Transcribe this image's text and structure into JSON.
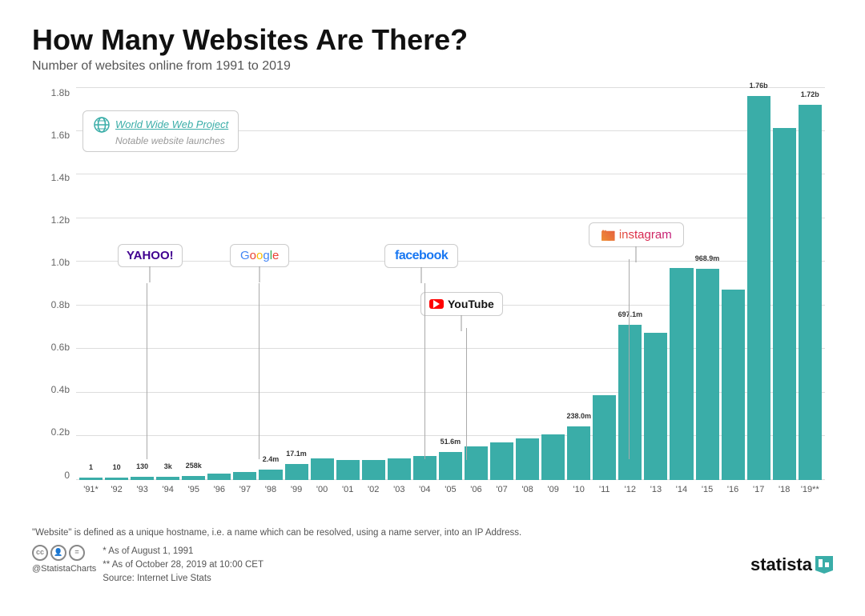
{
  "title": "How Many Websites Are There?",
  "subtitle": "Number of websites online from 1991 to 2019",
  "yLabels": [
    "0",
    "0.2b",
    "0.4b",
    "0.6b",
    "0.8b",
    "1.0b",
    "1.2b",
    "1.4b",
    "1.6b",
    "1.8b"
  ],
  "bars": [
    {
      "year": "'91*",
      "value": 1,
      "label": "1",
      "pct": 0.0006
    },
    {
      "year": "'92",
      "value": 10,
      "label": "10",
      "pct": 0.006
    },
    {
      "year": "'93",
      "value": 130,
      "label": "130",
      "pct": 0.007
    },
    {
      "year": "'94",
      "value": 3000,
      "label": "3k",
      "pct": 0.008
    },
    {
      "year": "'95",
      "value": 258000,
      "label": "258k",
      "pct": 0.01
    },
    {
      "year": "'96",
      "value": 0,
      "label": "",
      "pct": 0.015
    },
    {
      "year": "'97",
      "value": 0,
      "label": "",
      "pct": 0.02
    },
    {
      "year": "'98",
      "value": 2400000,
      "label": "2.4m",
      "pct": 0.025
    },
    {
      "year": "'99",
      "value": 17100000,
      "label": "17.1m",
      "pct": 0.04
    },
    {
      "year": "'00",
      "value": 0,
      "label": "",
      "pct": 0.055
    },
    {
      "year": "'01",
      "value": 0,
      "label": "",
      "pct": 0.05
    },
    {
      "year": "'02",
      "value": 0,
      "label": "",
      "pct": 0.05
    },
    {
      "year": "'03",
      "value": 0,
      "label": "",
      "pct": 0.055
    },
    {
      "year": "'04",
      "value": 0,
      "label": "",
      "pct": 0.06
    },
    {
      "year": "'05",
      "value": 51600000,
      "label": "51.6m",
      "pct": 0.07
    },
    {
      "year": "'06",
      "value": 0,
      "label": "",
      "pct": 0.085
    },
    {
      "year": "'07",
      "value": 0,
      "label": "",
      "pct": 0.095
    },
    {
      "year": "'08",
      "value": 0,
      "label": "",
      "pct": 0.105
    },
    {
      "year": "'09",
      "value": 0,
      "label": "",
      "pct": 0.115
    },
    {
      "year": "'10",
      "value": 238000000,
      "label": "238.0m",
      "pct": 0.135
    },
    {
      "year": "'11",
      "value": 0,
      "label": "",
      "pct": 0.215
    },
    {
      "year": "'12",
      "value": 697100000,
      "label": "697.1m",
      "pct": 0.395
    },
    {
      "year": "'13",
      "value": 0,
      "label": "",
      "pct": 0.375
    },
    {
      "year": "'14",
      "value": 0,
      "label": "",
      "pct": 0.54
    },
    {
      "year": "'15",
      "value": 968900000,
      "label": "968.9m",
      "pct": 0.538
    },
    {
      "year": "'16",
      "value": 0,
      "label": "",
      "pct": 0.485
    },
    {
      "year": "'17",
      "value": 1760000000,
      "label": "1.76b",
      "pct": 0.978
    },
    {
      "year": "'18",
      "value": 0,
      "label": "",
      "pct": 0.898
    },
    {
      "year": "'19**",
      "value": 1720000000,
      "label": "1.72b",
      "pct": 0.956
    }
  ],
  "annotations": [
    {
      "id": "wwwproject",
      "text": "World Wide Web Project",
      "subtext": "Notable website launches"
    },
    {
      "id": "yahoo",
      "text": "YAHOO!"
    },
    {
      "id": "google",
      "text": "Google"
    },
    {
      "id": "facebook",
      "text": "facebook"
    },
    {
      "id": "youtube",
      "text": "YouTube"
    },
    {
      "id": "instagram",
      "text": "instagram"
    }
  ],
  "footer": {
    "definition": "\"Website\" is defined as a unique hostname, i.e. a name which can be resolved, using a name server, into an IP Address.",
    "note1": "*  As of August 1, 1991",
    "note2": "** As of October 28, 2019 at 10:00 CET",
    "source": "Source: Internet Live Stats",
    "handle": "@StatistaCharts",
    "brand": "statista"
  }
}
